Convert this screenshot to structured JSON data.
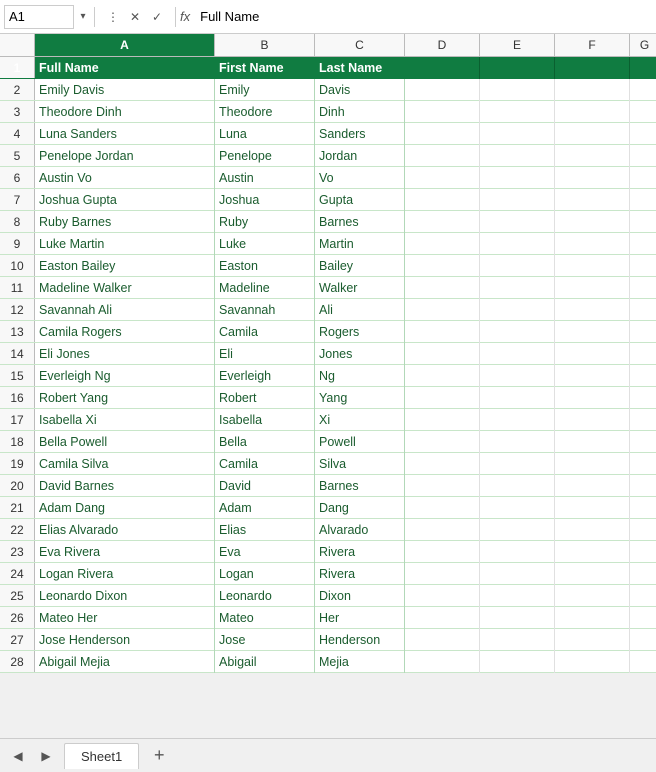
{
  "formulaBar": {
    "cellRef": "A1",
    "formulaText": "Full Name",
    "icons": [
      "kebab",
      "close",
      "check",
      "fx"
    ]
  },
  "columns": {
    "headers": [
      "",
      "A",
      "B",
      "C",
      "D",
      "E",
      "F",
      "G"
    ]
  },
  "rows": [
    {
      "rowNum": 1,
      "colA": "Full Name",
      "colB": "First Name",
      "colC": "Last Name",
      "isHeader": true
    },
    {
      "rowNum": 2,
      "colA": "Emily Davis",
      "colB": "Emily",
      "colC": "Davis"
    },
    {
      "rowNum": 3,
      "colA": "Theodore Dinh",
      "colB": "Theodore",
      "colC": "Dinh"
    },
    {
      "rowNum": 4,
      "colA": "Luna Sanders",
      "colB": "Luna",
      "colC": "Sanders"
    },
    {
      "rowNum": 5,
      "colA": "Penelope Jordan",
      "colB": "Penelope",
      "colC": "Jordan"
    },
    {
      "rowNum": 6,
      "colA": "Austin Vo",
      "colB": "Austin",
      "colC": "Vo"
    },
    {
      "rowNum": 7,
      "colA": "Joshua Gupta",
      "colB": "Joshua",
      "colC": "Gupta"
    },
    {
      "rowNum": 8,
      "colA": "Ruby Barnes",
      "colB": "Ruby",
      "colC": "Barnes"
    },
    {
      "rowNum": 9,
      "colA": "Luke Martin",
      "colB": "Luke",
      "colC": "Martin"
    },
    {
      "rowNum": 10,
      "colA": "Easton Bailey",
      "colB": "Easton",
      "colC": "Bailey"
    },
    {
      "rowNum": 11,
      "colA": "Madeline Walker",
      "colB": "Madeline",
      "colC": "Walker"
    },
    {
      "rowNum": 12,
      "colA": "Savannah Ali",
      "colB": "Savannah",
      "colC": "Ali"
    },
    {
      "rowNum": 13,
      "colA": "Camila Rogers",
      "colB": "Camila",
      "colC": "Rogers"
    },
    {
      "rowNum": 14,
      "colA": "Eli Jones",
      "colB": "Eli",
      "colC": "Jones"
    },
    {
      "rowNum": 15,
      "colA": "Everleigh Ng",
      "colB": "Everleigh",
      "colC": "Ng"
    },
    {
      "rowNum": 16,
      "colA": "Robert Yang",
      "colB": "Robert",
      "colC": "Yang"
    },
    {
      "rowNum": 17,
      "colA": "Isabella Xi",
      "colB": "Isabella",
      "colC": "Xi"
    },
    {
      "rowNum": 18,
      "colA": "Bella Powell",
      "colB": "Bella",
      "colC": "Powell"
    },
    {
      "rowNum": 19,
      "colA": "Camila Silva",
      "colB": "Camila",
      "colC": "Silva"
    },
    {
      "rowNum": 20,
      "colA": "David Barnes",
      "colB": "David",
      "colC": "Barnes"
    },
    {
      "rowNum": 21,
      "colA": "Adam Dang",
      "colB": "Adam",
      "colC": "Dang"
    },
    {
      "rowNum": 22,
      "colA": "Elias Alvarado",
      "colB": "Elias",
      "colC": "Alvarado"
    },
    {
      "rowNum": 23,
      "colA": "Eva Rivera",
      "colB": "Eva",
      "colC": "Rivera"
    },
    {
      "rowNum": 24,
      "colA": "Logan Rivera",
      "colB": "Logan",
      "colC": "Rivera"
    },
    {
      "rowNum": 25,
      "colA": "Leonardo Dixon",
      "colB": "Leonardo",
      "colC": "Dixon"
    },
    {
      "rowNum": 26,
      "colA": "Mateo Her",
      "colB": "Mateo",
      "colC": "Her"
    },
    {
      "rowNum": 27,
      "colA": "Jose Henderson",
      "colB": "Jose",
      "colC": "Henderson"
    },
    {
      "rowNum": 28,
      "colA": "Abigail Mejia",
      "colB": "Abigail",
      "colC": "Mejia"
    }
  ],
  "tabs": {
    "sheets": [
      "Sheet1"
    ],
    "addLabel": "+"
  },
  "colors": {
    "headerBg": "#107c41",
    "headerText": "#ffffff",
    "borderColor": "#107c41",
    "rowBorder": "#d4e8da"
  }
}
